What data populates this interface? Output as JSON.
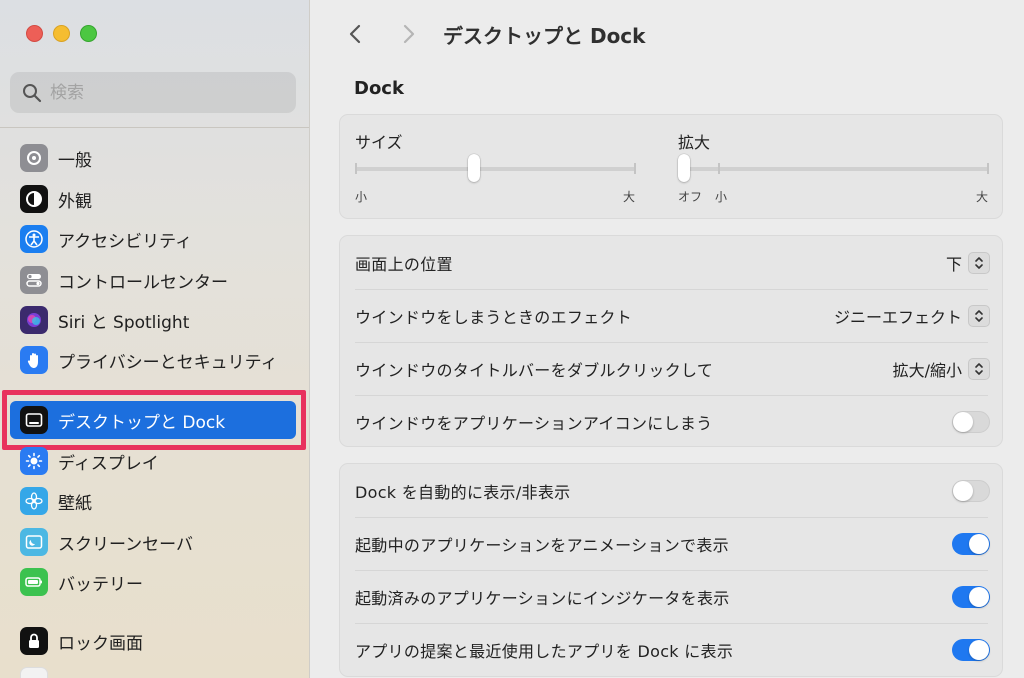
{
  "sidebar": {
    "search_placeholder": "検索",
    "items": [
      {
        "label": "一般",
        "icon": "gear-icon",
        "color": "#8e8e93"
      },
      {
        "label": "外観",
        "icon": "appearance-icon",
        "color": "#111111"
      },
      {
        "label": "アクセシビリティ",
        "icon": "accessibility-icon",
        "color": "#1a7ef0"
      },
      {
        "label": "コントロールセンター",
        "icon": "control-center-icon",
        "color": "#8e8e93"
      },
      {
        "label": "Siri と Spotlight",
        "icon": "siri-icon",
        "color": "#3b2a6d"
      },
      {
        "label": "プライバシーとセキュリティ",
        "icon": "hand-icon",
        "color": "#2a7bf2"
      },
      {
        "label": "デスクトップと Dock",
        "icon": "dock-icon",
        "color": "#111111"
      },
      {
        "label": "ディスプレイ",
        "icon": "display-icon",
        "color": "#2a7bf2"
      },
      {
        "label": "壁紙",
        "icon": "wallpaper-icon",
        "color": "#35a7e8"
      },
      {
        "label": "スクリーンセーバ",
        "icon": "screensaver-icon",
        "color": "#4cb8e3"
      },
      {
        "label": "バッテリー",
        "icon": "battery-icon",
        "color": "#3cc24f"
      },
      {
        "label": "ロック画面",
        "icon": "lock-icon",
        "color": "#111111"
      }
    ],
    "active_index": 6
  },
  "header": {
    "title": "デスクトップと Dock"
  },
  "dock_section": {
    "heading": "Dock",
    "size": {
      "label": "サイズ",
      "min_label": "小",
      "max_label": "大",
      "level": 0.42
    },
    "magnify": {
      "label": "拡大",
      "off_label": "オフ",
      "min_label": "小",
      "max_label": "大",
      "level": 0.0
    }
  },
  "group1": [
    {
      "label": "画面上の位置",
      "type": "popup",
      "value": "下"
    },
    {
      "label": "ウインドウをしまうときのエフェクト",
      "type": "popup",
      "value": "ジニーエフェクト"
    },
    {
      "label": "ウインドウのタイトルバーをダブルクリックして",
      "type": "popup",
      "value": "拡大/縮小"
    },
    {
      "label": "ウインドウをアプリケーションアイコンにしまう",
      "type": "toggle",
      "on": false
    }
  ],
  "group2": [
    {
      "label": "Dock を自動的に表示/非表示",
      "type": "toggle",
      "on": false
    },
    {
      "label": "起動中のアプリケーションをアニメーションで表示",
      "type": "toggle",
      "on": true
    },
    {
      "label": "起動済みのアプリケーションにインジケータを表示",
      "type": "toggle",
      "on": true
    },
    {
      "label": "アプリの提案と最近使用したアプリを Dock に表示",
      "type": "toggle",
      "on": true
    }
  ],
  "colors": {
    "accent": "#1c6fde",
    "highlight": "#e8325d",
    "toggle_on": "#1f78f0"
  }
}
